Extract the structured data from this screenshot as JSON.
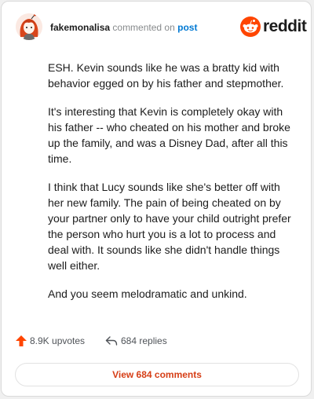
{
  "comment": {
    "username": "fakemonalisa",
    "action_text": "commented on",
    "post_link": "post",
    "paragraphs": [
      "ESH. Kevin sounds like he was a bratty kid with behavior egged on by his father and stepmother.",
      "It's interesting that Kevin is completely okay with his father -- who cheated on his mother and broke up the family, and was a Disney Dad, after all this time.",
      "I think that Lucy sounds like she's better off with her new family. The pain of being cheated on by your partner only to have your child outright prefer the person who hurt you is a lot to process and deal with. It sounds like she didn't handle things well either.",
      "And you seem melodramatic and unkind."
    ]
  },
  "brand": {
    "wordmark": "reddit",
    "color": "#ff4500"
  },
  "stats": {
    "upvotes": "8.9K upvotes",
    "replies": "684 replies",
    "upvote_icon": "upvote-arrow-icon",
    "reply_icon": "reply-arrow-icon"
  },
  "actions": {
    "view_comments": "View 684 comments"
  },
  "colors": {
    "username": "#1c1c1c",
    "meta": "#878a8c",
    "link": "#0079d3",
    "upvote": "#ff4500",
    "button_text": "#d63e16"
  }
}
